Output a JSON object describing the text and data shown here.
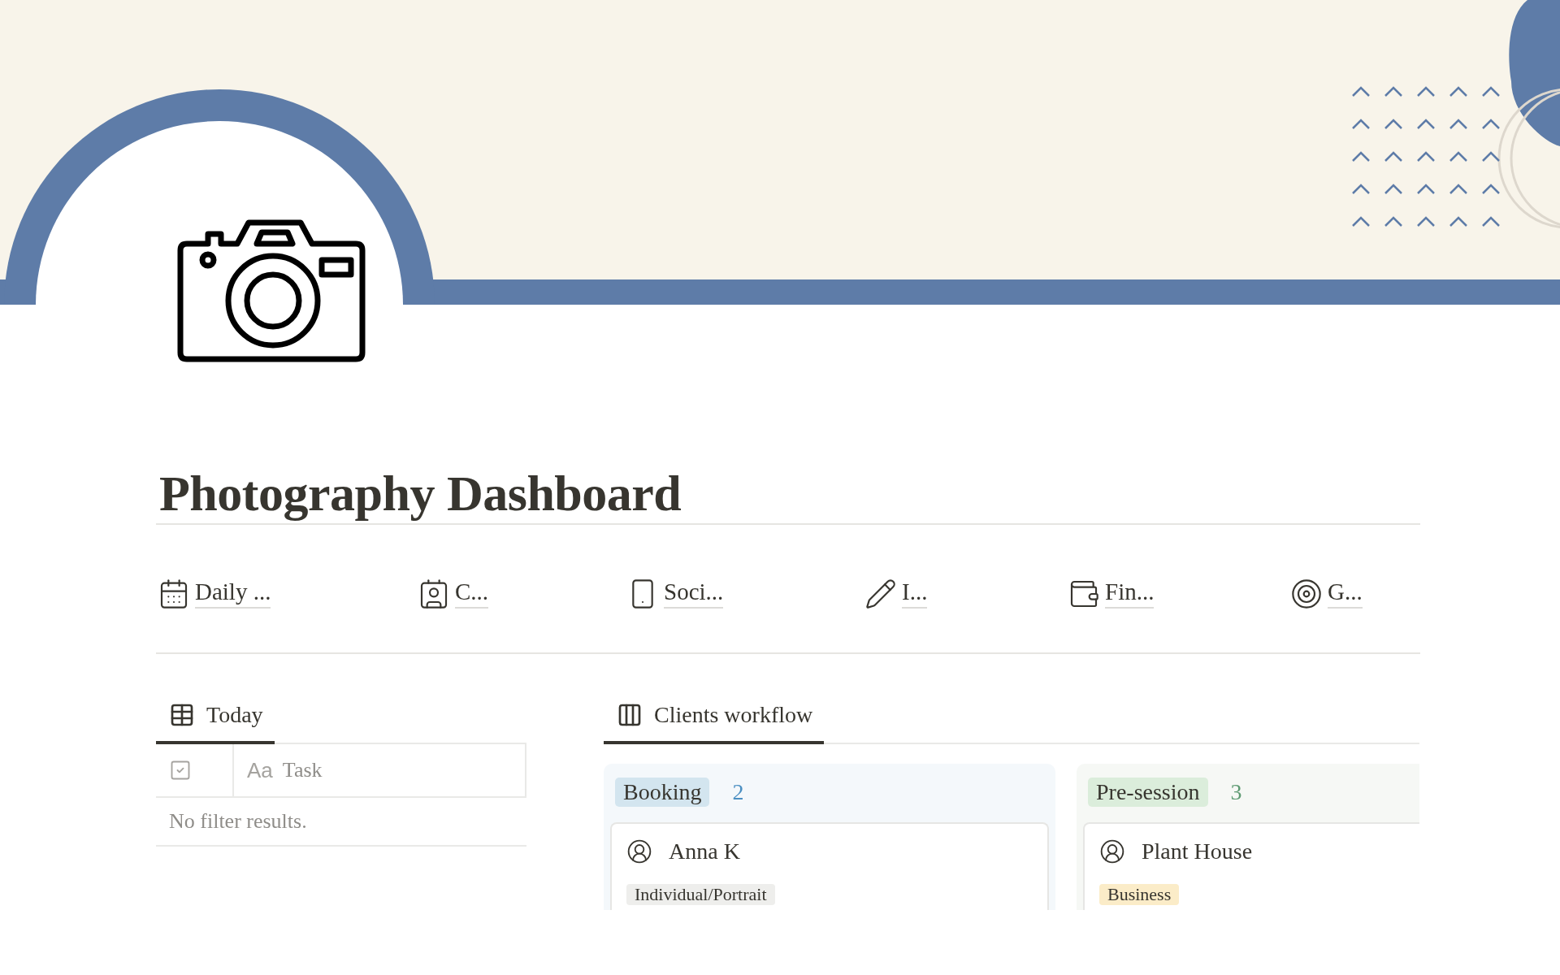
{
  "page": {
    "title": "Photography Dashboard"
  },
  "links": [
    {
      "label": "Daily ..."
    },
    {
      "label": "C..."
    },
    {
      "label": "Soci..."
    },
    {
      "label": "I..."
    },
    {
      "label": "Fin..."
    },
    {
      "label": "G..."
    }
  ],
  "views": [
    {
      "tab": {
        "label": "Today",
        "kind": "table",
        "selected": true
      },
      "table": {
        "columns": [
          {
            "kind": "checkbox"
          },
          {
            "kind": "text",
            "prefix": "Aa",
            "label": "Task"
          }
        ],
        "empty_message": "No filter results."
      }
    },
    {
      "tab": {
        "label": "Clients workflow",
        "kind": "board",
        "selected": true
      },
      "board": {
        "columns": [
          {
            "label": "Booking",
            "count": "2",
            "color": "#d3e5ef",
            "cards": [
              {
                "title": "Anna K",
                "tag": {
                  "label": "Individual/Portrait",
                  "color": "#eeeeec"
                }
              }
            ]
          },
          {
            "label": "Pre-session",
            "count": "3",
            "color": "#dbeddb",
            "cards": [
              {
                "title": "Plant House",
                "tag": {
                  "label": "Business",
                  "color": "#fbecc8"
                }
              }
            ]
          }
        ]
      }
    }
  ]
}
